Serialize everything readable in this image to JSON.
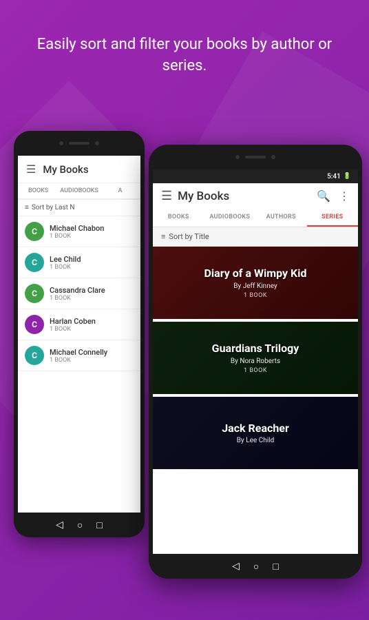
{
  "page": {
    "headline": "Easily sort and filter your books by\nauthor or series.",
    "background_color": "#9c27b0"
  },
  "left_phone": {
    "header": {
      "menu_icon": "☰",
      "title": "My Books"
    },
    "tabs": [
      {
        "label": "BOOKS",
        "active": false
      },
      {
        "label": "AUDIOBOOKS",
        "active": false
      },
      {
        "label": "A",
        "active": false
      }
    ],
    "sort_bar": {
      "icon": "≡",
      "label": "Sort by Last N"
    },
    "authors": [
      {
        "initial": "C",
        "name": "Michael Chabon",
        "count": "1 BOOK",
        "color": "#43a047"
      },
      {
        "initial": "C",
        "name": "Lee Child",
        "count": "1 BOOK",
        "color": "#26a69a"
      },
      {
        "initial": "C",
        "name": "Cassandra Clare",
        "count": "1 BOOK",
        "color": "#43a047"
      },
      {
        "initial": "C",
        "name": "Harlan Coben",
        "count": "1 BOOK",
        "color": "#8e24aa"
      },
      {
        "initial": "C",
        "name": "Michael Connelly",
        "count": "1 BOOK",
        "color": "#26a69a"
      }
    ]
  },
  "right_phone": {
    "status_bar": {
      "time": "5:41",
      "battery": "🔋"
    },
    "header": {
      "menu_icon": "☰",
      "title": "My Books",
      "search_icon": "🔍",
      "more_icon": "⋮"
    },
    "tabs": [
      {
        "label": "BOOKS",
        "active": false
      },
      {
        "label": "AUDIOBOOKS",
        "active": false
      },
      {
        "label": "AUTHORS",
        "active": false
      },
      {
        "label": "SERIES",
        "active": true
      }
    ],
    "sort_bar": {
      "icon": "≡",
      "label": "Sort by Title"
    },
    "series": [
      {
        "title": "Diary of a Wimpy Kid",
        "author": "By Jeff Kinney",
        "count": "1 BOOK",
        "bg_class": "bg-diary"
      },
      {
        "title": "Guardians Trilogy",
        "author": "By Nora Roberts",
        "count": "1 BOOK",
        "bg_class": "bg-guardians"
      },
      {
        "title": "Jack Reacher",
        "author": "By Lee Child",
        "count": "",
        "bg_class": "bg-jack"
      }
    ]
  },
  "nav": {
    "back": "◁",
    "home": "○",
    "recent": "□"
  }
}
